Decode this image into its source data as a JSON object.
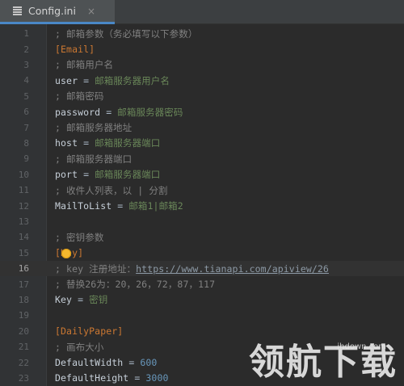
{
  "tab": {
    "label": "Config.ini",
    "close": "×"
  },
  "lines": [
    {
      "n": "1",
      "parts": [
        {
          "t": "; 邮箱参数（务必填写以下参数）",
          "c": "comment"
        }
      ]
    },
    {
      "n": "2",
      "parts": [
        {
          "t": "[Email]",
          "c": "section"
        }
      ]
    },
    {
      "n": "3",
      "parts": [
        {
          "t": "; 邮箱用户名",
          "c": "comment"
        }
      ]
    },
    {
      "n": "4",
      "parts": [
        {
          "t": "user",
          "c": "key"
        },
        {
          "t": " = ",
          "c": "op"
        },
        {
          "t": "邮箱服务器用户名",
          "c": "val"
        }
      ]
    },
    {
      "n": "5",
      "parts": [
        {
          "t": "; 邮箱密码",
          "c": "comment"
        }
      ]
    },
    {
      "n": "6",
      "parts": [
        {
          "t": "password",
          "c": "key"
        },
        {
          "t": " = ",
          "c": "op"
        },
        {
          "t": "邮箱服务器密码",
          "c": "val"
        }
      ]
    },
    {
      "n": "7",
      "parts": [
        {
          "t": "; 邮箱服务器地址",
          "c": "comment"
        }
      ]
    },
    {
      "n": "8",
      "parts": [
        {
          "t": "host",
          "c": "key"
        },
        {
          "t": " = ",
          "c": "op"
        },
        {
          "t": "邮箱服务器端口",
          "c": "val"
        }
      ]
    },
    {
      "n": "9",
      "parts": [
        {
          "t": "; 邮箱服务器端口",
          "c": "comment"
        }
      ]
    },
    {
      "n": "10",
      "parts": [
        {
          "t": "port",
          "c": "key"
        },
        {
          "t": " = ",
          "c": "op"
        },
        {
          "t": "邮箱服务器端口",
          "c": "val"
        }
      ]
    },
    {
      "n": "11",
      "parts": [
        {
          "t": "; 收件人列表，以 | 分割",
          "c": "comment"
        }
      ]
    },
    {
      "n": "12",
      "parts": [
        {
          "t": "MailToList",
          "c": "key"
        },
        {
          "t": " = ",
          "c": "op"
        },
        {
          "t": "邮箱1|邮箱2",
          "c": "val"
        }
      ]
    },
    {
      "n": "13",
      "parts": []
    },
    {
      "n": "14",
      "parts": [
        {
          "t": "; 密钥参数",
          "c": "comment"
        }
      ]
    },
    {
      "n": "15",
      "parts": [
        {
          "t": "[Key]",
          "c": "section"
        }
      ]
    },
    {
      "n": "16",
      "parts": [
        {
          "t": "; key 注册地址：",
          "c": "comment"
        },
        {
          "t": "https://www.tianapi.com/apiview/26",
          "c": "url"
        }
      ],
      "current": true
    },
    {
      "n": "17",
      "parts": [
        {
          "t": "; 替换26为：20，26，72，87，117",
          "c": "comment"
        }
      ]
    },
    {
      "n": "18",
      "parts": [
        {
          "t": "Key",
          "c": "key"
        },
        {
          "t": " = ",
          "c": "op"
        },
        {
          "t": "密钥",
          "c": "val"
        }
      ]
    },
    {
      "n": "19",
      "parts": []
    },
    {
      "n": "20",
      "parts": [
        {
          "t": "[DailyPaper]",
          "c": "section"
        }
      ]
    },
    {
      "n": "21",
      "parts": [
        {
          "t": "; 画布大小",
          "c": "comment"
        }
      ]
    },
    {
      "n": "22",
      "parts": [
        {
          "t": "DefaultWidth",
          "c": "key"
        },
        {
          "t": " = ",
          "c": "op"
        },
        {
          "t": "600",
          "c": "num"
        }
      ]
    },
    {
      "n": "23",
      "parts": [
        {
          "t": "DefaultHeight",
          "c": "key"
        },
        {
          "t": " = ",
          "c": "op"
        },
        {
          "t": "3000",
          "c": "num"
        }
      ]
    }
  ],
  "watermark": {
    "domain": "ihdown.com",
    "text": "领航下载"
  },
  "colors": {
    "background": "#2b2b2b",
    "comment": "#808080",
    "section": "#cc7832",
    "value": "#6a8759",
    "number": "#6897bb",
    "hint_bulb": "#f5b82e"
  }
}
